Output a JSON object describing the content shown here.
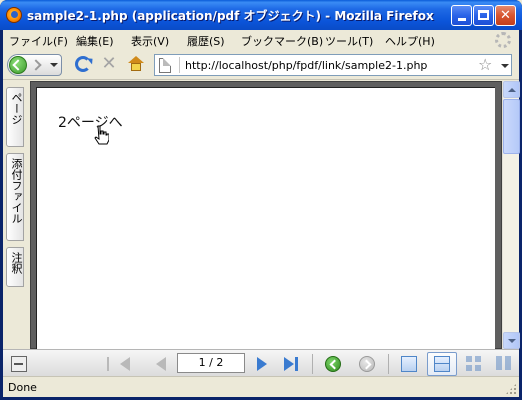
{
  "window": {
    "title": "sample2-1.php (application/pdf オブジェクト) - Mozilla Firefox"
  },
  "menu": {
    "items": [
      "ファイル(F)",
      "編集(E)",
      "表示(V)",
      "履歴(S)",
      "ブックマーク(B)",
      "ツール(T)",
      "ヘルプ(H)"
    ]
  },
  "navbar": {
    "url": "http://localhost/php/fpdf/link/sample2-1.php"
  },
  "sidebar": {
    "tabs": [
      "ページ",
      "添付ファイル",
      "注釈"
    ]
  },
  "document": {
    "link_text": "2ページへ"
  },
  "pdf_toolbar": {
    "page_indicator": "1 / 2"
  },
  "status": {
    "text": "Done"
  },
  "icons": {
    "app": "firefox-icon",
    "back": "back-arrow-icon",
    "forward": "forward-arrow-icon",
    "reload": "reload-icon",
    "stop": "stop-icon",
    "home": "home-icon",
    "bookmark": "star-icon",
    "cursor": "hand-cursor-icon"
  }
}
